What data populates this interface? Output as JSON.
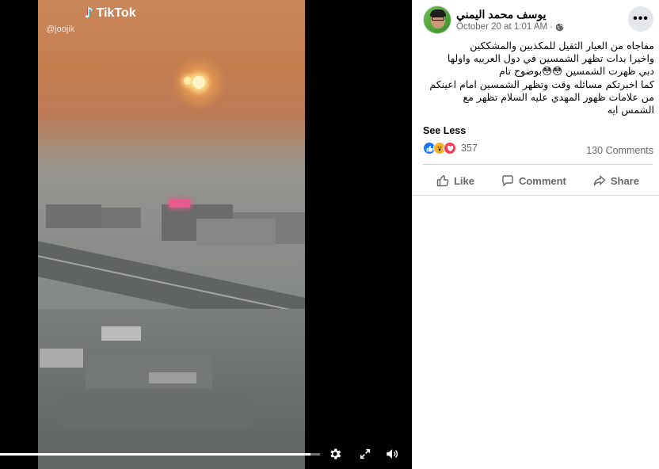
{
  "video": {
    "watermark_brand": "TikTok",
    "watermark_handle": "@joojik",
    "progress_fraction": 0.97
  },
  "controls": {
    "settings_icon": "gear-icon",
    "fullscreen_icon": "expand-icon",
    "volume_icon": "volume-icon"
  },
  "post": {
    "author": "يوسف محمد اليمني",
    "timestamp": "October 20 at 1:01 AM",
    "separator": "·",
    "privacy_icon": "globe-icon",
    "more_label": "•••",
    "text_lines": [
      "مفاجاه من العيار الثقيل للمكذبين والمشككين",
      "واخيرا بدات تظهر الشمسين في دول العربيه واولها",
      "دبي ظهرت الشمسين 😳😳بوضوح تام",
      "كما اخبرتكم مسائله وقت وتظهر الشمسين امام اعينكم",
      "من علامات ظهور المهدي عليه السلام تظهر مع",
      "الشمس ايه"
    ],
    "see_less": "See Less",
    "reaction_count": "357",
    "comments_count": "130 Comments",
    "actions": {
      "like": "Like",
      "comment": "Comment",
      "share": "Share"
    }
  },
  "colors": {
    "facebook_blue": "#1877f2",
    "secondary_text": "#65676b"
  }
}
